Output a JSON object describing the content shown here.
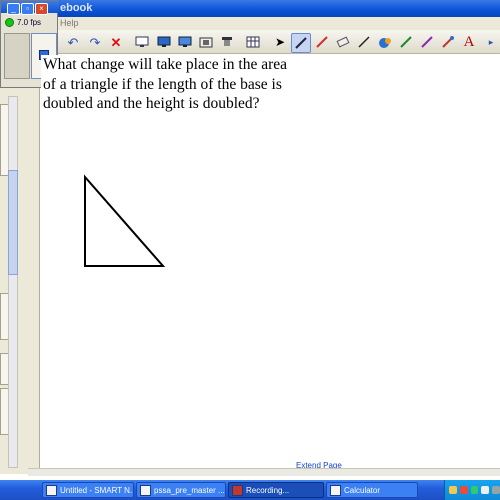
{
  "window": {
    "title_fragment": "ebook",
    "menu_visible": "Help"
  },
  "recorder": {
    "fps_label": "7.0 fps"
  },
  "toolbar": {
    "tools": [
      "undo-icon",
      "redo-icon",
      "delete-icon",
      "screen-shade-icon",
      "display-icon",
      "monitor-icon",
      "capture-icon",
      "document-camera-icon",
      "table-icon",
      "select-pointer-icon",
      "pen-icon",
      "creative-pen-icon",
      "eraser-icon",
      "line-icon",
      "fill-icon",
      "magic-pen-icon",
      "properties-pen-icon",
      "recognition-icon",
      "text-icon"
    ]
  },
  "page": {
    "question": "What change will take place in the area\nof a triangle if the length of the base is\ndoubled and the height is doubled?",
    "extend_label": "Extend Page"
  },
  "taskbar": {
    "items": [
      {
        "label": "Untitled - SMART N...",
        "active": false
      },
      {
        "label": "pssa_pre_master ...",
        "active": false
      },
      {
        "label": "Recording...",
        "active": true
      },
      {
        "label": "Calculator",
        "active": false
      }
    ]
  },
  "colors": {
    "taskbar": "#245edb",
    "titlebar": "#0a52d6",
    "link": "#1844c9"
  }
}
